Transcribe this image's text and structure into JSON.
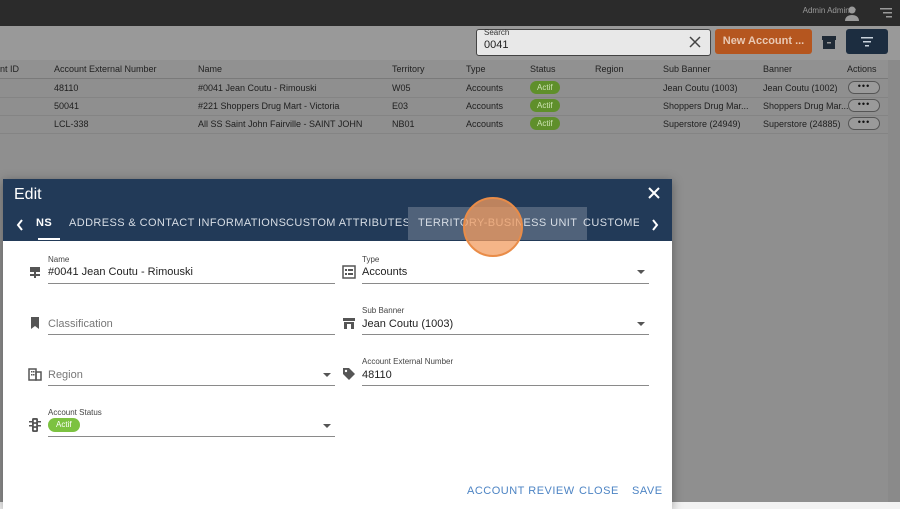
{
  "topbar": {
    "user_label": "Admin Admin ▾"
  },
  "search": {
    "label": "Search",
    "value": "0041"
  },
  "toolbar": {
    "new_account_label": "New Account ..."
  },
  "grid": {
    "headers": [
      "nt ID",
      "Account External Number",
      "Name",
      "Territory",
      "Type",
      "Status",
      "Region",
      "Sub Banner",
      "Banner",
      "Actions"
    ],
    "rows": [
      {
        "ext": "48110",
        "name": "#0041 Jean Coutu - Rimouski",
        "territory": "W05",
        "type": "Accounts",
        "status": "Actif",
        "sub_banner": "Jean Coutu (1003)",
        "banner": "Jean Coutu (1002)"
      },
      {
        "ext": "50041",
        "name": "#221 Shoppers Drug Mart - Victoria",
        "territory": "E03",
        "type": "Accounts",
        "status": "Actif",
        "sub_banner": "Shoppers Drug Mar...",
        "banner": "Shoppers Drug Mar..."
      },
      {
        "ext": "LCL-338",
        "name": "All SS Saint John Fairville - SAINT JOHN",
        "territory": "NB01",
        "type": "Accounts",
        "status": "Actif",
        "sub_banner": "Superstore (24949)",
        "banner": "Superstore (24885)"
      }
    ],
    "actions_label": "•••"
  },
  "dialog": {
    "title": "Edit",
    "tabs": [
      {
        "label": "NS"
      },
      {
        "label": "ADDRESS & CONTACT INFORMATIONS"
      },
      {
        "label": "CUSTOM ATTRIBUTES"
      },
      {
        "label": "TERRITORY-BUSINESS UNIT"
      },
      {
        "label": "CUSTOMER"
      }
    ],
    "fields": {
      "name": {
        "label": "Name",
        "value": "#0041 Jean Coutu - Rimouski"
      },
      "type": {
        "label": "Type",
        "value": "Accounts"
      },
      "classification": {
        "placeholder": "Classification"
      },
      "sub_banner": {
        "label": "Sub Banner",
        "value": "Jean Coutu (1003)"
      },
      "region": {
        "placeholder": "Region"
      },
      "ext_number": {
        "label": "Account External Number",
        "value": "48110"
      },
      "status": {
        "label": "Account Status",
        "value": "Actif"
      }
    },
    "footer": {
      "review": "ACCOUNT REVIEW",
      "close": "CLOSE",
      "save": "SAVE"
    }
  },
  "colors": {
    "accent": "#4d84c4",
    "header": "#223a58",
    "new_account": "#b5561f",
    "status_green": "#7cc241"
  }
}
